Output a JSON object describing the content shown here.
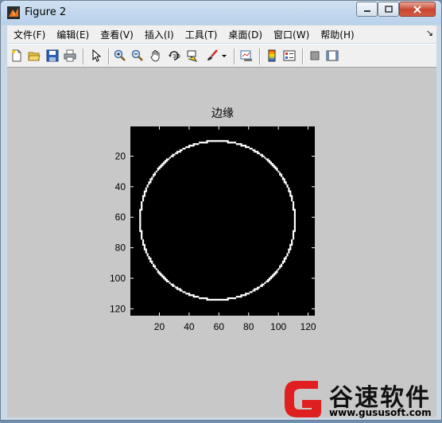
{
  "window": {
    "title": "Figure 2"
  },
  "menu": [
    {
      "label": "文件(F)"
    },
    {
      "label": "编辑(E)"
    },
    {
      "label": "查看(V)"
    },
    {
      "label": "插入(I)"
    },
    {
      "label": "工具(T)"
    },
    {
      "label": "桌面(D)"
    },
    {
      "label": "窗口(W)"
    },
    {
      "label": "帮助(H)"
    }
  ],
  "toolbar_icons": [
    "new-figure-icon",
    "open-file-icon",
    "save-icon",
    "print-icon",
    "pointer-icon",
    "zoom-in-icon",
    "zoom-out-icon",
    "pan-icon",
    "rotate-3d-icon",
    "data-cursor-icon",
    "brush-icon",
    "brush-dropdown-icon",
    "link-plot-icon",
    "colorbar-icon",
    "legend-icon",
    "hide-plot-tools-icon",
    "show-plot-tools-icon"
  ],
  "chart_data": {
    "type": "heatmap",
    "title": "边缘",
    "xlim": [
      0.5,
      124.5
    ],
    "ylim": [
      0.5,
      124.5
    ],
    "xticks": [
      20,
      40,
      60,
      80,
      100,
      120
    ],
    "yticks": [
      20,
      40,
      60,
      80,
      100,
      120
    ],
    "y_reversed": true,
    "background_color": "#000000",
    "edge_color": "#ffffff",
    "circle": {
      "center_x": 59,
      "center_y": 62,
      "radius": 52
    }
  },
  "watermark": {
    "text": "谷速软件",
    "url": "www.gususoft.com"
  }
}
